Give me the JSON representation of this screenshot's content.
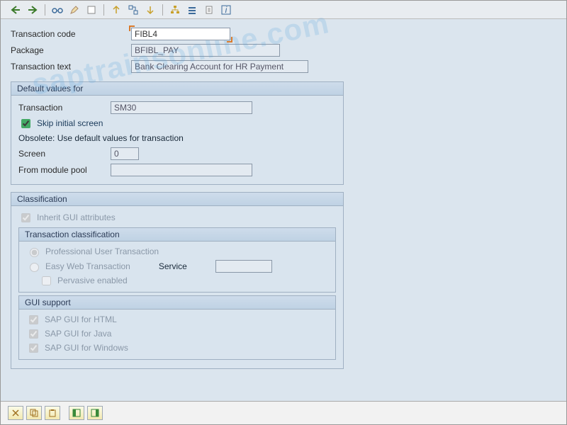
{
  "header": {
    "labels": {
      "tcode": "Transaction code",
      "package": "Package",
      "ttext": "Transaction text"
    },
    "values": {
      "tcode": "FIBL4",
      "package": "BFIBL_PAY",
      "ttext": "Bank Clearing Account for HR Payment"
    }
  },
  "defaults": {
    "title": "Default values for",
    "labels": {
      "transaction": "Transaction",
      "screen": "Screen",
      "from_pool": "From module pool"
    },
    "values": {
      "transaction": "SM30",
      "screen": "0",
      "from_pool": ""
    },
    "skip_label": "Skip initial screen",
    "obsolete": "Obsolete: Use default values for transaction"
  },
  "classification": {
    "title": "Classification",
    "inherit": "Inherit GUI attributes",
    "tx_class": {
      "title": "Transaction classification",
      "prof": "Professional User Transaction",
      "easy": "Easy Web Transaction",
      "service_lbl": "Service",
      "pervasive": "Pervasive enabled"
    },
    "gui": {
      "title": "GUI support",
      "html": "SAP GUI for HTML",
      "java": "SAP GUI for Java",
      "win": "SAP GUI for Windows"
    }
  }
}
